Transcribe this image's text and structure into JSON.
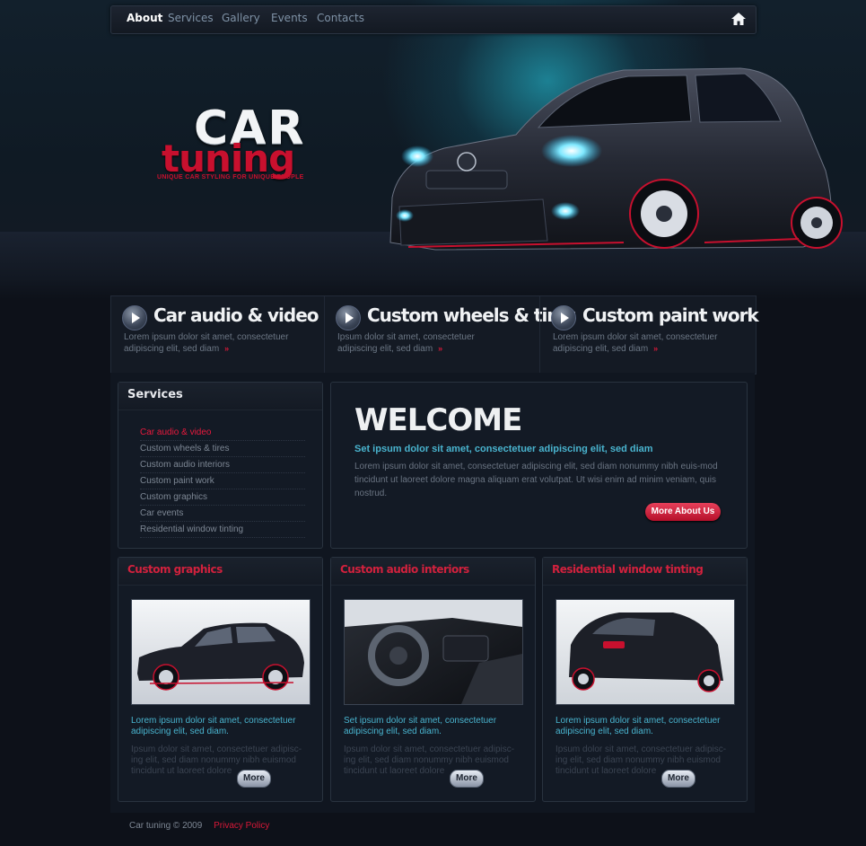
{
  "nav": {
    "items": [
      {
        "label": "About",
        "active": true
      },
      {
        "label": "Services",
        "active": false
      },
      {
        "label": "Gallery",
        "active": false
      },
      {
        "label": "Events",
        "active": false
      },
      {
        "label": "Contacts",
        "active": false
      }
    ],
    "home_icon": "home-icon"
  },
  "logo": {
    "line1": "CAR",
    "line2": "tuning",
    "slogan": "UNIQUE CAR STYLING FOR UNIQUE PEOPLE"
  },
  "features": [
    {
      "title": "Car audio & video",
      "text": "Lorem ipsum dolor sit amet, consectetuer adipiscing elit, sed diam",
      "arrows": "»"
    },
    {
      "title": "Custom wheels & tires",
      "text": "Ipsum dolor sit amet, consectetuer adipiscing elit, sed diam",
      "arrows": "»"
    },
    {
      "title": "Custom paint work",
      "text": "Lorem ipsum dolor sit amet, consectetuer adipiscing elit, sed diam",
      "arrows": "»"
    }
  ],
  "services": {
    "title": "Services",
    "items": [
      "Car audio & video",
      "Custom wheels & tires",
      "Custom audio interiors",
      "Custom paint work",
      "Custom graphics",
      "Car events",
      "Residential window tinting"
    ]
  },
  "welcome": {
    "title": "WELCOME",
    "subtitle": "Set ipsum dolor sit amet, consectetuer adipiscing elit, sed diam",
    "body": "Lorem ipsum dolor sit amet, consectetuer adipiscing elit, sed diam nonummy nibh euis-mod tincidunt ut laoreet dolore magna aliquam erat volutpat. Ut wisi enim ad minim veniam, quis nostrud.",
    "button": "More About Us"
  },
  "cards": [
    {
      "title": "Custom graphics",
      "highlight": "Lorem ipsum dolor sit amet, consectetuer adipiscing elit, sed diam.",
      "body": "Ipsum dolor sit amet, consectetuer adipisc-ing elit, sed diam nonummy nibh euismod tincidunt ut laoreet dolore",
      "button": "More"
    },
    {
      "title": "Custom audio interiors",
      "highlight": "Set ipsum dolor sit amet, consectetuer adipiscing elit, sed diam.",
      "body": "Ipsum dolor sit amet, consectetuer adipisc-ing elit, sed diam nonummy nibh euismod tincidunt ut laoreet dolore",
      "button": "More"
    },
    {
      "title": "Residential window tinting",
      "highlight": "Lorem ipsum dolor sit amet, consectetuer adipiscing elit, sed diam.",
      "body": "Ipsum dolor sit amet, consectetuer adipisc-ing elit, sed diam nonummy nibh euismod tincidunt ut laoreet dolore",
      "button": "More"
    }
  ],
  "footer": {
    "copyright": "Car tuning © 2009",
    "privacy": "Privacy Policy"
  },
  "colors": {
    "accent_red": "#d81838",
    "accent_cyan": "#49b4cf",
    "background": "#0d1119"
  }
}
